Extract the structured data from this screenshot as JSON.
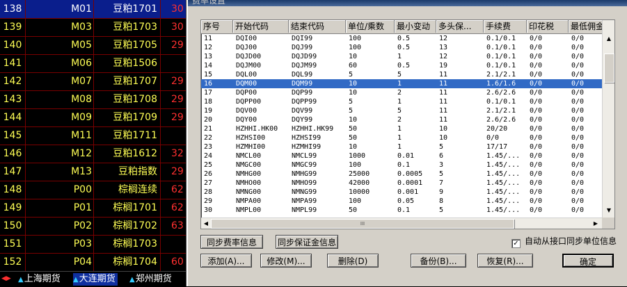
{
  "quote_list": {
    "rows": [
      {
        "seq": "138",
        "code": "M01",
        "name": "豆粕1701",
        "price": "30",
        "selected": true
      },
      {
        "seq": "139",
        "code": "M03",
        "name": "豆粕1703",
        "price": "30"
      },
      {
        "seq": "140",
        "code": "M05",
        "name": "豆粕1705",
        "price": "29"
      },
      {
        "seq": "141",
        "code": "M06",
        "name": "豆粕1506",
        "price": ""
      },
      {
        "seq": "142",
        "code": "M07",
        "name": "豆粕1707",
        "price": "29"
      },
      {
        "seq": "143",
        "code": "M08",
        "name": "豆粕1708",
        "price": "29"
      },
      {
        "seq": "144",
        "code": "M09",
        "name": "豆粕1709",
        "price": "29"
      },
      {
        "seq": "145",
        "code": "M11",
        "name": "豆粕1711",
        "price": ""
      },
      {
        "seq": "146",
        "code": "M12",
        "name": "豆粕1612",
        "price": "32"
      },
      {
        "seq": "147",
        "code": "M13",
        "name": "豆粕指数",
        "price": "29"
      },
      {
        "seq": "148",
        "code": "P00",
        "name": "棕榈连续",
        "price": "62"
      },
      {
        "seq": "149",
        "code": "P01",
        "name": "棕榈1701",
        "price": "62"
      },
      {
        "seq": "150",
        "code": "P02",
        "name": "棕榈1702",
        "price": "63"
      },
      {
        "seq": "151",
        "code": "P03",
        "name": "棕榈1703",
        "price": ""
      },
      {
        "seq": "152",
        "code": "P04",
        "name": "棕榈1704",
        "price": "60"
      }
    ]
  },
  "tabs": [
    {
      "label": "上海期货",
      "active": false
    },
    {
      "label": "大连期货",
      "active": true
    },
    {
      "label": "郑州期货",
      "active": false
    }
  ],
  "dialog": {
    "title": "费率设置",
    "columns": [
      "序号",
      "开始代码",
      "结束代码",
      "单位/乘数",
      "最小变动",
      "多头保...",
      "手续费",
      "印花税",
      "最低佣金"
    ],
    "rows": [
      [
        "11",
        "DQI00",
        "DQI99",
        "100",
        "0.5",
        "12",
        "0.1/0.1",
        "0/0",
        "0/0"
      ],
      [
        "12",
        "DQJ00",
        "DQJ99",
        "100",
        "0.5",
        "13",
        "0.1/0.1",
        "0/0",
        "0/0"
      ],
      [
        "13",
        "DQJD00",
        "DQJD99",
        "10",
        "1",
        "12",
        "0.1/0.1",
        "0/0",
        "0/0"
      ],
      [
        "14",
        "DQJM00",
        "DQJM99",
        "60",
        "0.5",
        "19",
        "0.1/0.1",
        "0/0",
        "0/0"
      ],
      [
        "15",
        "DQL00",
        "DQL99",
        "5",
        "5",
        "11",
        "2.1/2.1",
        "0/0",
        "0/0"
      ],
      [
        "16",
        "DQM00",
        "DQM99",
        "10",
        "1",
        "11",
        "1.6/1.6",
        "0/0",
        "0/0"
      ],
      [
        "17",
        "DQP00",
        "DQP99",
        "10",
        "2",
        "11",
        "2.6/2.6",
        "0/0",
        "0/0"
      ],
      [
        "18",
        "DQPP00",
        "DQPP99",
        "5",
        "1",
        "11",
        "0.1/0.1",
        "0/0",
        "0/0"
      ],
      [
        "19",
        "DQV00",
        "DQV99",
        "5",
        "5",
        "11",
        "2.1/2.1",
        "0/0",
        "0/0"
      ],
      [
        "20",
        "DQY00",
        "DQY99",
        "10",
        "2",
        "11",
        "2.6/2.6",
        "0/0",
        "0/0"
      ],
      [
        "21",
        "HZHHI.HK00",
        "HZHHI.HK99",
        "50",
        "1",
        "10",
        "20/20",
        "0/0",
        "0/0"
      ],
      [
        "22",
        "HZHSI00",
        "HZHSI99",
        "50",
        "1",
        "10",
        "0/0",
        "0/0",
        "0/0"
      ],
      [
        "23",
        "HZMHI00",
        "HZMHI99",
        "10",
        "1",
        "5",
        "17/17",
        "0/0",
        "0/0"
      ],
      [
        "24",
        "NMCL00",
        "NMCL99",
        "1000",
        "0.01",
        "6",
        "1.45/...",
        "0/0",
        "0/0"
      ],
      [
        "25",
        "NMGC00",
        "NMGC99",
        "100",
        "0.1",
        "3",
        "1.45/...",
        "0/0",
        "0/0"
      ],
      [
        "26",
        "NMHG00",
        "NMHG99",
        "25000",
        "0.0005",
        "5",
        "1.45/...",
        "0/0",
        "0/0"
      ],
      [
        "27",
        "NMHO00",
        "NMHO99",
        "42000",
        "0.0001",
        "7",
        "1.45/...",
        "0/0",
        "0/0"
      ],
      [
        "28",
        "NMNG00",
        "NMNG99",
        "10000",
        "0.001",
        "9",
        "1.45/...",
        "0/0",
        "0/0"
      ],
      [
        "29",
        "NMPA00",
        "NMPA99",
        "100",
        "0.05",
        "8",
        "1.45/...",
        "0/0",
        "0/0"
      ],
      [
        "30",
        "NMPL00",
        "NMPL99",
        "50",
        "0.1",
        "5",
        "1.45/...",
        "0/0",
        "0/0"
      ]
    ],
    "selected_row": 5,
    "hscroll_grip": "III",
    "buttons": {
      "sync_rate": "同步费率信息",
      "sync_margin": "同步保证金信息",
      "add": "添加(A)...",
      "edit": "修改(M)...",
      "delete": "删除(D)",
      "backup": "备份(B)...",
      "restore": "恢复(R)...",
      "ok": "确定"
    },
    "auto_sync_label": "自动从接口同步单位信息",
    "auto_sync_checked": true
  },
  "icons": {
    "scroll_up": "scroll-up-arrow-icon",
    "scroll_down": "scroll-down-arrow-icon",
    "scroll_left": "scroll-left-arrow-icon",
    "scroll_right": "scroll-right-arrow-icon",
    "tab_triangle": "triangle-icon"
  },
  "colors": {
    "selected_row": "#316ac5",
    "quote_text": "#ffff55",
    "quote_price": "#ff3030",
    "quote_selected_bg": "#0a1e8c",
    "grid_line": "#7a0000"
  }
}
